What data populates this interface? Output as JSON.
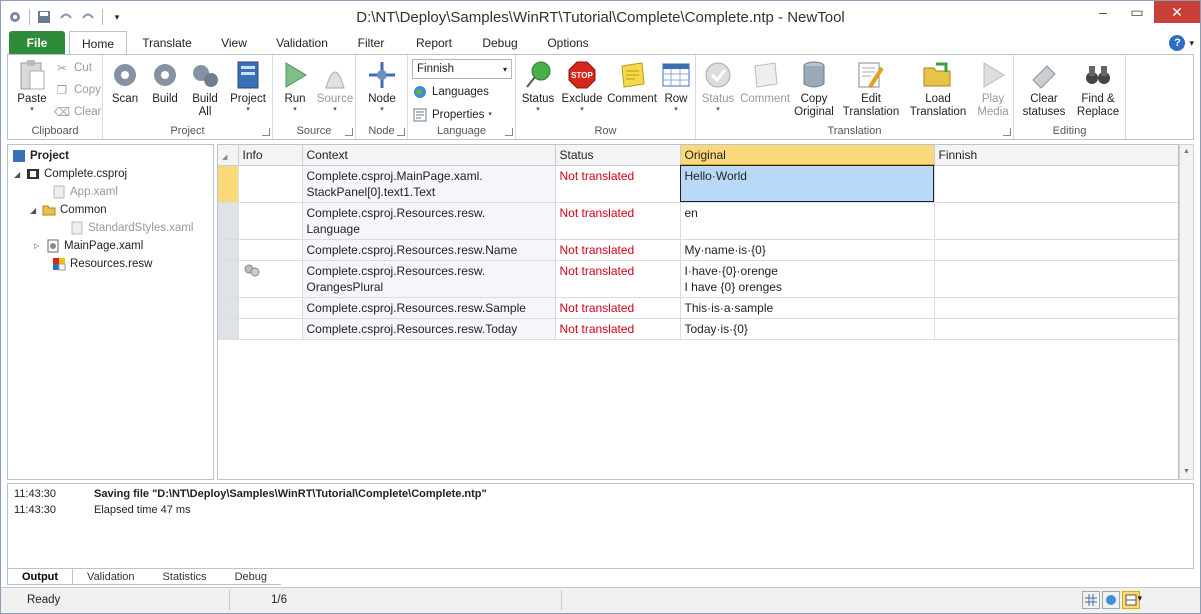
{
  "window": {
    "title": "D:\\NT\\Deploy\\Samples\\WinRT\\Tutorial\\Complete\\Complete.ntp - NewTool",
    "icons": [
      "gear-icon",
      "save-icon",
      "undo-icon",
      "redo-icon",
      "customize-icon"
    ]
  },
  "tabs": [
    "File",
    "Home",
    "Translate",
    "View",
    "Validation",
    "Filter",
    "Report",
    "Debug",
    "Options"
  ],
  "ribbon": {
    "clipboard": {
      "label": "Clipboard",
      "paste": "Paste",
      "cut": "Cut",
      "copy": "Copy",
      "clear": "Clear"
    },
    "project": {
      "label": "Project",
      "scan": "Scan",
      "build": "Build",
      "build_all_1": "Build",
      "build_all_2": "All",
      "project": "Project"
    },
    "source": {
      "label": "Source",
      "run": "Run",
      "source": "Source"
    },
    "node": {
      "label": "Node",
      "node": "Node"
    },
    "language": {
      "label": "Language",
      "selected": "Finnish",
      "languages": "Languages",
      "properties": "Properties"
    },
    "row": {
      "label": "Row",
      "status": "Status",
      "exclude": "Exclude",
      "comment": "Comment",
      "row": "Row"
    },
    "translation": {
      "label": "Translation",
      "status": "Status",
      "comment": "Comment",
      "copy_original_1": "Copy",
      "copy_original_2": "Original",
      "edit_translation_1": "Edit",
      "edit_translation_2": "Translation",
      "load_translation_1": "Load",
      "load_translation_2": "Translation",
      "play_media_1": "Play",
      "play_media_2": "Media"
    },
    "editing": {
      "label": "Editing",
      "clear_statuses_1": "Clear",
      "clear_statuses_2": "statuses",
      "find_replace_1": "Find &",
      "find_replace_2": "Replace"
    }
  },
  "tree": {
    "root": "Project",
    "items": [
      {
        "label": "Complete.csproj"
      },
      {
        "label": "App.xaml"
      },
      {
        "label": "Common"
      },
      {
        "label": "StandardStyles.xaml"
      },
      {
        "label": "MainPage.xaml"
      },
      {
        "label": "Resources.resw"
      }
    ]
  },
  "grid": {
    "columns": [
      "Info",
      "Context",
      "Status",
      "Original",
      "Finnish"
    ],
    "rows": [
      {
        "context_1": "Complete.csproj.MainPage.xaml.",
        "context_2": "StackPanel[0].text1.Text",
        "status": "Not translated",
        "original_1": "Hello·World",
        "original_2": "",
        "finnish": ""
      },
      {
        "context_1": "Complete.csproj.Resources.resw.",
        "context_2": "Language",
        "status": "Not translated",
        "original_1": "en",
        "original_2": "",
        "finnish": ""
      },
      {
        "context_1": "Complete.csproj.Resources.resw.Name",
        "context_2": "",
        "status": "Not translated",
        "original_1": "My·name·is·{0}",
        "original_2": "",
        "finnish": ""
      },
      {
        "context_1": "Complete.csproj.Resources.resw.",
        "context_2": "OrangesPlural",
        "status": "Not translated",
        "original_1": "I·have·{0}·orenge",
        "original_2": "I have {0} orenges",
        "finnish": ""
      },
      {
        "context_1": "Complete.csproj.Resources.resw.Sample",
        "context_2": "",
        "status": "Not translated",
        "original_1": "This·is·a·sample",
        "original_2": "",
        "finnish": ""
      },
      {
        "context_1": "Complete.csproj.Resources.resw.Today",
        "context_2": "",
        "status": "Not translated",
        "original_1": "Today·is·{0}",
        "original_2": "",
        "finnish": ""
      }
    ]
  },
  "output": {
    "lines": [
      {
        "time": "11:43:30",
        "text": "Saving file \"D:\\NT\\Deploy\\Samples\\WinRT\\Tutorial\\Complete\\Complete.ntp\""
      },
      {
        "time": "11:43:30",
        "text": "Elapsed time 47 ms"
      }
    ],
    "tabs": [
      "Output",
      "Validation",
      "Statistics",
      "Debug"
    ]
  },
  "statusbar": {
    "state": "Ready",
    "position": "1/6"
  },
  "colors": {
    "file_tab": "#2e8b3a",
    "not_translated": "#d2001a",
    "selected_column": "#f9d97a",
    "selected_cell": "#b8d9f8"
  }
}
